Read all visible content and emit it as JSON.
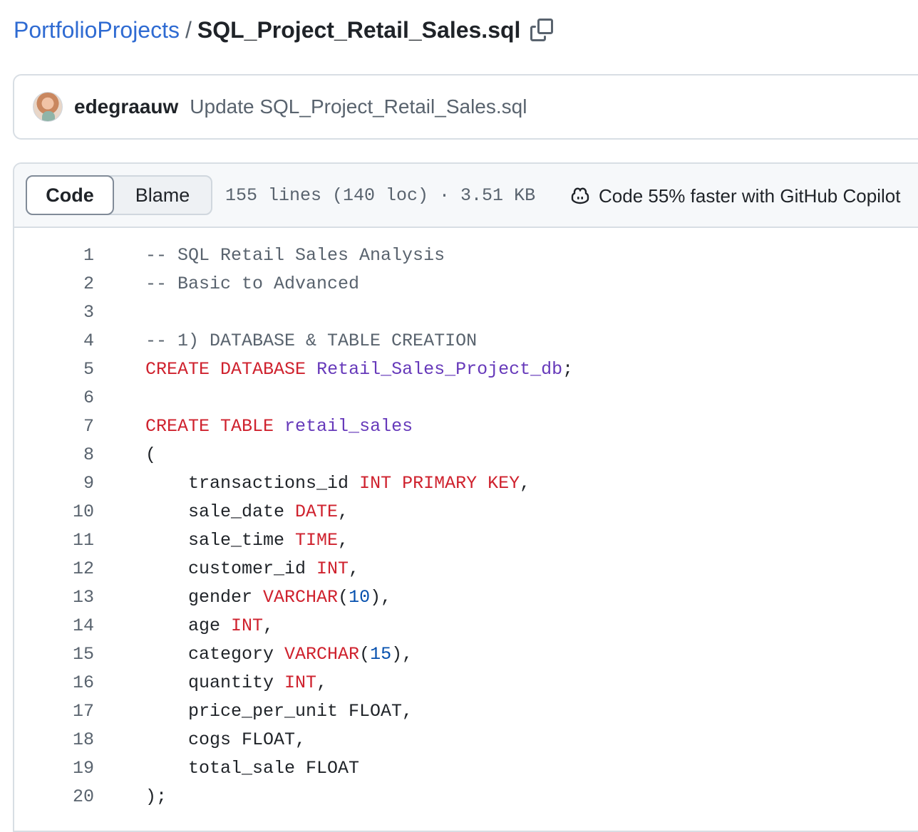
{
  "breadcrumb": {
    "repo": "PortfolioProjects",
    "separator": "/",
    "file": "SQL_Project_Retail_Sales.sql",
    "copy_icon": "copy-icon"
  },
  "commit": {
    "author": "edegraauw",
    "message": "Update SQL_Project_Retail_Sales.sql"
  },
  "file_header": {
    "code_tab": "Code",
    "blame_tab": "Blame",
    "meta": "155 lines (140 loc) · 3.51 KB",
    "copilot": "Code 55% faster with GitHub Copilot",
    "copilot_icon": "copilot-icon"
  },
  "colors": {
    "link": "#2f6bd2",
    "keyword": "#cf222e",
    "entity": "#6639ba",
    "number": "#0550ae",
    "comment": "#59636e"
  },
  "code_lines": [
    {
      "n": "1",
      "tokens": [
        {
          "t": "-- SQL Retail Sales Analysis",
          "k": "com"
        }
      ]
    },
    {
      "n": "2",
      "tokens": [
        {
          "t": "-- Basic to Advanced",
          "k": "com"
        }
      ]
    },
    {
      "n": "3",
      "tokens": []
    },
    {
      "n": "4",
      "tokens": [
        {
          "t": "-- 1) DATABASE & TABLE CREATION",
          "k": "com"
        }
      ]
    },
    {
      "n": "5",
      "tokens": [
        {
          "t": "CREATE DATABASE",
          "k": "kw"
        },
        {
          "t": " ",
          "k": "plain"
        },
        {
          "t": "Retail_Sales_Project_db",
          "k": "ent"
        },
        {
          "t": ";",
          "k": "plain"
        }
      ]
    },
    {
      "n": "6",
      "tokens": []
    },
    {
      "n": "7",
      "tokens": [
        {
          "t": "CREATE TABLE",
          "k": "kw"
        },
        {
          "t": " ",
          "k": "plain"
        },
        {
          "t": "retail_sales",
          "k": "ent"
        }
      ]
    },
    {
      "n": "8",
      "tokens": [
        {
          "t": "(",
          "k": "plain"
        }
      ]
    },
    {
      "n": "9",
      "tokens": [
        {
          "t": "    transactions_id ",
          "k": "plain"
        },
        {
          "t": "INT PRIMARY KEY",
          "k": "kw"
        },
        {
          "t": ",",
          "k": "plain"
        }
      ]
    },
    {
      "n": "10",
      "tokens": [
        {
          "t": "    sale_date ",
          "k": "plain"
        },
        {
          "t": "DATE",
          "k": "kw"
        },
        {
          "t": ",",
          "k": "plain"
        }
      ]
    },
    {
      "n": "11",
      "tokens": [
        {
          "t": "    sale_time ",
          "k": "plain"
        },
        {
          "t": "TIME",
          "k": "kw"
        },
        {
          "t": ",",
          "k": "plain"
        }
      ]
    },
    {
      "n": "12",
      "tokens": [
        {
          "t": "    customer_id ",
          "k": "plain"
        },
        {
          "t": "INT",
          "k": "kw"
        },
        {
          "t": ",",
          "k": "plain"
        }
      ]
    },
    {
      "n": "13",
      "tokens": [
        {
          "t": "    gender ",
          "k": "plain"
        },
        {
          "t": "VARCHAR",
          "k": "kw"
        },
        {
          "t": "(",
          "k": "plain"
        },
        {
          "t": "10",
          "k": "num"
        },
        {
          "t": "),",
          "k": "plain"
        }
      ]
    },
    {
      "n": "14",
      "tokens": [
        {
          "t": "    age ",
          "k": "plain"
        },
        {
          "t": "INT",
          "k": "kw"
        },
        {
          "t": ",",
          "k": "plain"
        }
      ]
    },
    {
      "n": "15",
      "tokens": [
        {
          "t": "    category ",
          "k": "plain"
        },
        {
          "t": "VARCHAR",
          "k": "kw"
        },
        {
          "t": "(",
          "k": "plain"
        },
        {
          "t": "15",
          "k": "num"
        },
        {
          "t": "),",
          "k": "plain"
        }
      ]
    },
    {
      "n": "16",
      "tokens": [
        {
          "t": "    quantity ",
          "k": "plain"
        },
        {
          "t": "INT",
          "k": "kw"
        },
        {
          "t": ",",
          "k": "plain"
        }
      ]
    },
    {
      "n": "17",
      "tokens": [
        {
          "t": "    price_per_unit FLOAT,",
          "k": "plain"
        }
      ]
    },
    {
      "n": "18",
      "tokens": [
        {
          "t": "    cogs FLOAT,",
          "k": "plain"
        }
      ]
    },
    {
      "n": "19",
      "tokens": [
        {
          "t": "    total_sale FLOAT",
          "k": "plain"
        }
      ]
    },
    {
      "n": "20",
      "tokens": [
        {
          "t": ");",
          "k": "plain"
        }
      ]
    }
  ]
}
